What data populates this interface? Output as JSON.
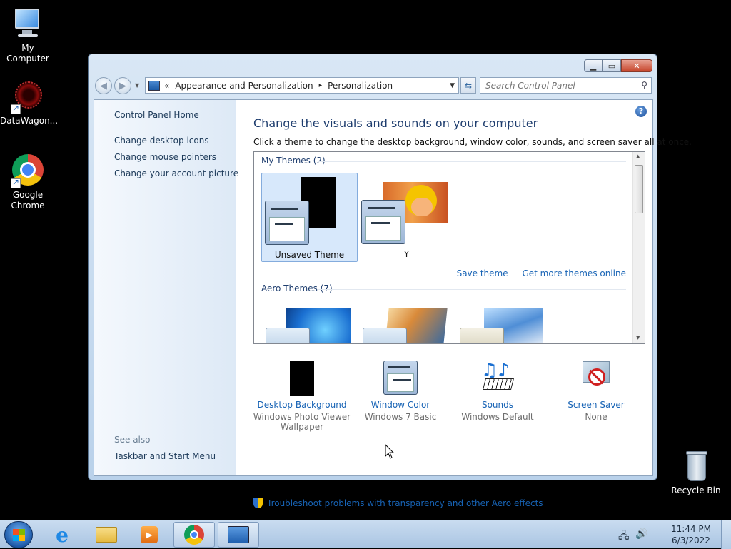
{
  "desktop": {
    "icons": [
      {
        "label": "My Computer"
      },
      {
        "label": "DataWagon..."
      },
      {
        "label": "Google Chrome"
      },
      {
        "label": "Recycle Bin"
      }
    ]
  },
  "window": {
    "caption_buttons": {
      "minimize": "▁",
      "maximize": "▭",
      "close": "✕"
    },
    "address": {
      "chevron": "«",
      "crumb1": "Appearance and Personalization",
      "separator": "▸",
      "crumb2": "Personalization"
    },
    "search": {
      "placeholder": "Search Control Panel"
    },
    "left_pane": {
      "home": "Control Panel Home",
      "links": [
        "Change desktop icons",
        "Change mouse pointers",
        "Change your account picture"
      ],
      "see_also": "See also",
      "see_also_link": "Taskbar and Start Menu"
    },
    "main": {
      "title": "Change the visuals and sounds on your computer",
      "subtitle": "Click a theme to change the desktop background, window color, sounds, and screen saver all at once.",
      "my_themes_header": "My Themes (2)",
      "themes": [
        {
          "name": "Unsaved Theme",
          "selected": true
        },
        {
          "name": "Y",
          "selected": false
        }
      ],
      "save_theme": "Save theme",
      "get_more": "Get more themes online",
      "aero_header": "Aero Themes (7)",
      "bottom": [
        {
          "link": "Desktop Background",
          "sub1": "Windows Photo Viewer",
          "sub2": "Wallpaper"
        },
        {
          "link": "Window Color",
          "sub1": "Windows 7 Basic",
          "sub2": ""
        },
        {
          "link": "Sounds",
          "sub1": "Windows Default",
          "sub2": ""
        },
        {
          "link": "Screen Saver",
          "sub1": "None",
          "sub2": ""
        }
      ],
      "troubleshoot": "Troubleshoot problems with transparency and other Aero effects"
    }
  },
  "taskbar": {
    "time": "11:44 PM",
    "date": "6/3/2022"
  },
  "colors": {
    "link": "#1763b5",
    "title": "#1e3d6e",
    "selection": "#d7e8fb"
  }
}
